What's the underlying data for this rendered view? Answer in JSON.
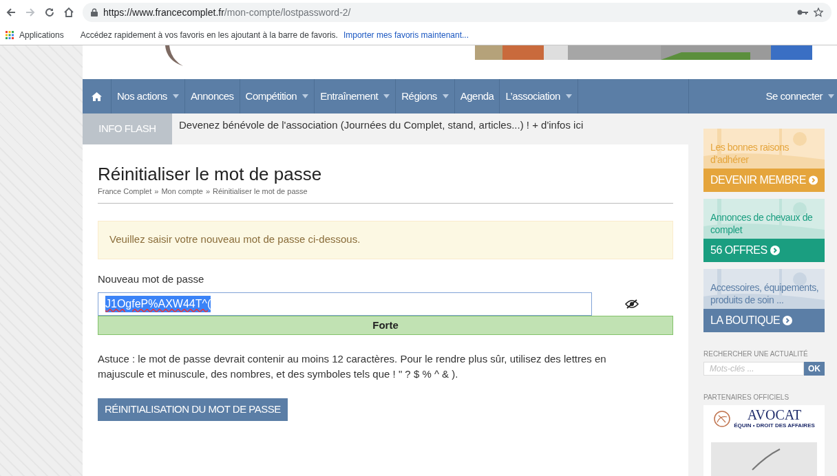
{
  "browser": {
    "url_host": "https://www.francecomplet.fr",
    "url_path": "/mon-compte/lostpassword-2/",
    "bookmarks_apps": "Applications",
    "bookmarks_hint": "Accédez rapidement à vos favoris en les ajoutant à la barre de favoris.",
    "bookmarks_import": "Importer mes favoris maintenant..."
  },
  "nav": {
    "items": [
      {
        "label": "Nos actions",
        "dropdown": true
      },
      {
        "label": "Annonces",
        "dropdown": false
      },
      {
        "label": "Compétition",
        "dropdown": true
      },
      {
        "label": "Entraînement",
        "dropdown": true
      },
      {
        "label": "Régions",
        "dropdown": true
      },
      {
        "label": "Agenda",
        "dropdown": false
      },
      {
        "label": "L’association",
        "dropdown": true
      }
    ],
    "login": {
      "label": "Se connecter",
      "dropdown": true
    }
  },
  "info_flash": {
    "label": "INFO FLASH",
    "text": "Devenez bénévole de l'association (Journées du Complet, stand, articles...) ! + d'infos ici"
  },
  "page": {
    "title": "Réinitialiser le mot de passe",
    "breadcrumb": [
      "France Complet",
      "Mon compte",
      "Réinitialiser le mot de passe"
    ],
    "breadcrumb_sep": "»",
    "notice": "Veuillez saisir votre nouveau mot de passe ci-dessous.",
    "field_label": "Nouveau mot de passe",
    "password": "J1OgfeP%AXW44T^(",
    "password_selected": true,
    "strength": {
      "label": "Forte",
      "strong": true
    },
    "hint": "Astuce : le mot de passe devrait contenir au moins 12 caractères. Pour le rendre plus sûr, utilisez des lettres en majuscule et minuscule, des nombres, et des symboles tels que ! \" ? $ % ^ & ).",
    "submit": "RÉINITIALISATION DU MOT DE PASSE"
  },
  "sidebar": {
    "promos": [
      {
        "text": "Les bonnes raisons d’adhérer",
        "button": "DEVENIR MEMBRE",
        "color": "#e5a53c"
      },
      {
        "text": "Annonces de chevaux de complet",
        "button": "56 OFFRES",
        "color": "#1a9e80"
      },
      {
        "text": "Accessoires, équipements, produits de soin ...",
        "button": "LA BOUTIQUE",
        "color": "#5b7ea6"
      }
    ],
    "search_title": "RECHERCHER UNE ACTUALITÉ",
    "search_placeholder": "Mots-clés ...",
    "search_button": "OK",
    "partners_title": "PARTENAIRES OFFICIELS",
    "partner_name": "AVOCAT",
    "partner_tagline": "ÉQUIN • DROIT DES AFFAIRES"
  }
}
